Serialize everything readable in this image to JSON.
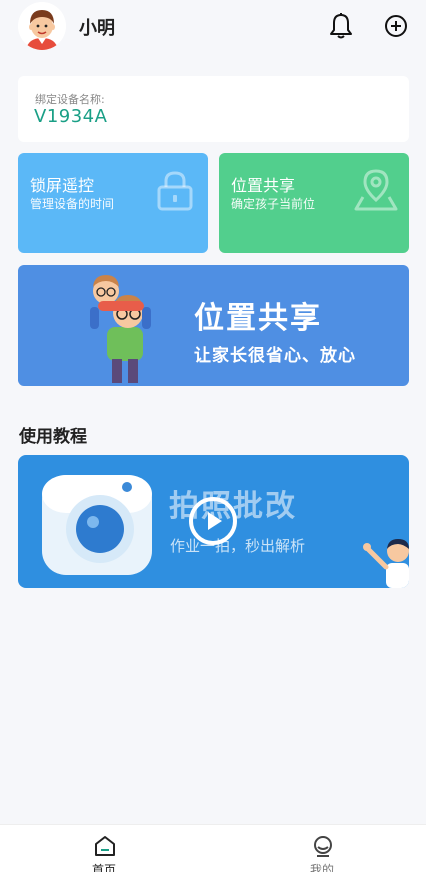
{
  "header": {
    "username": "小明",
    "icons": [
      "avatar",
      "bell-icon",
      "add-circle-icon"
    ]
  },
  "device": {
    "label": "绑定设备名称:",
    "name": "V1934A"
  },
  "features": [
    {
      "title": "锁屏遥控",
      "subtitle": "管理设备的时间",
      "icon": "lock-icon",
      "color": "#5bb8f7"
    },
    {
      "title": "位置共享",
      "subtitle": "确定孩子当前位",
      "icon": "map-pin-icon",
      "color": "#52cf8d"
    }
  ],
  "banner": {
    "title": "位置共享",
    "subtitle": "让家长很省心、放心",
    "color": "#4f8fe3"
  },
  "tutorial": {
    "section_title": "使用教程",
    "video_title": "拍照批改",
    "video_subtitle": "作业一拍，秒出解析",
    "color": "#2f8fe0"
  },
  "tabbar": {
    "tabs": [
      {
        "label": "首页",
        "icon": "home-icon",
        "active": true
      },
      {
        "label": "我的",
        "icon": "profile-icon",
        "active": false
      }
    ]
  }
}
